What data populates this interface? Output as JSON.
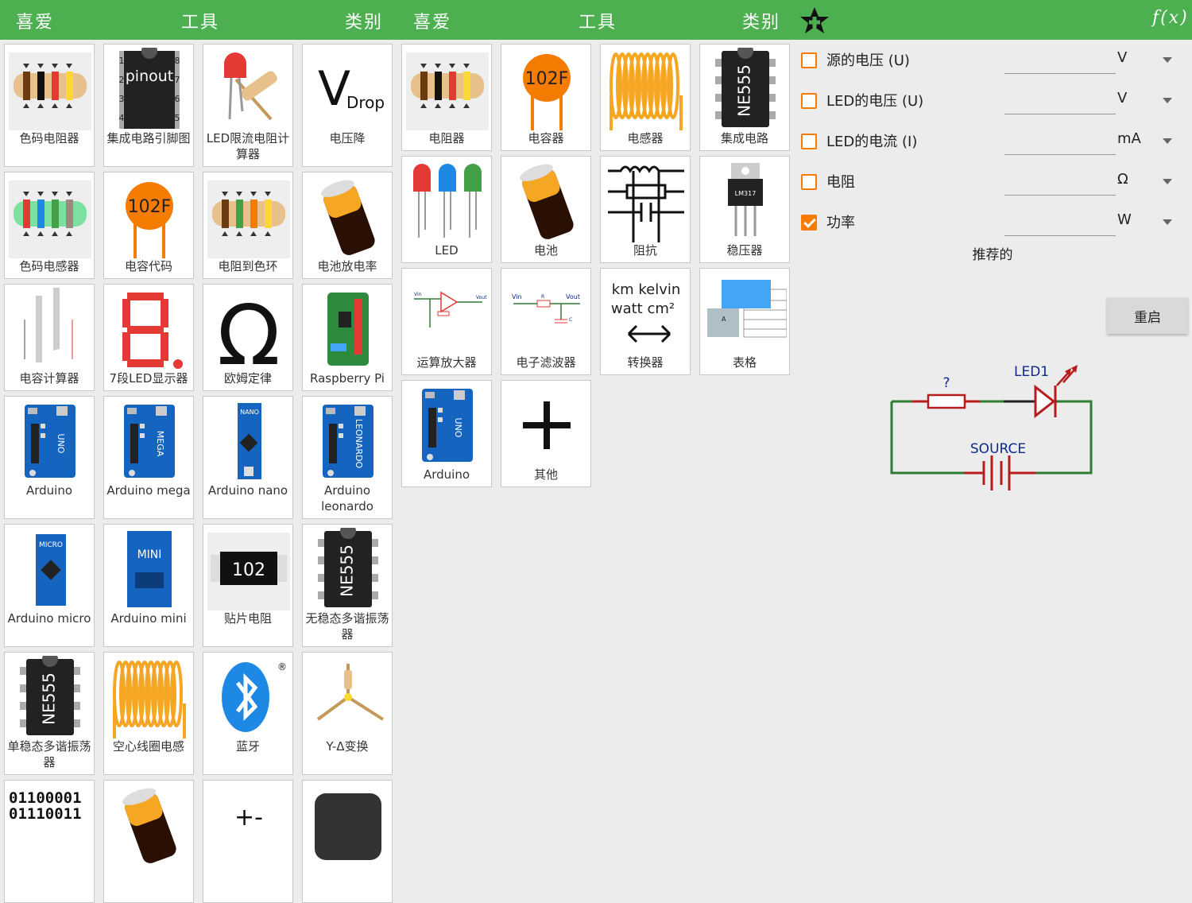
{
  "header_left": {
    "fav": "喜爱",
    "tools": "工具",
    "cat": "类别"
  },
  "header_mid": {
    "fav": "喜爱",
    "tools": "工具",
    "cat": "类别"
  },
  "header_right": {
    "fx": "f(x)"
  },
  "tools_grid": [
    {
      "label": "色码电阻器",
      "icon": "color-resistor-icon"
    },
    {
      "label": "集成电路引脚图",
      "icon": "ic-pinout-icon"
    },
    {
      "label": "LED限流电阻计算器",
      "icon": "led-resistor-icon"
    },
    {
      "label": "电压降",
      "icon": "vdrop-icon"
    },
    {
      "label": "色码电感器",
      "icon": "color-inductor-icon"
    },
    {
      "label": "电容代码",
      "icon": "capacitor-code-icon"
    },
    {
      "label": "电阻到色环",
      "icon": "resistor-to-color-icon"
    },
    {
      "label": "电池放电率",
      "icon": "battery-icon"
    },
    {
      "label": "电容计算器",
      "icon": "capacitor-plates-icon"
    },
    {
      "label": "7段LED显示器",
      "icon": "seven-segment-icon"
    },
    {
      "label": "欧姆定律",
      "icon": "omega-icon"
    },
    {
      "label": "Raspberry Pi",
      "icon": "raspberry-pi-icon"
    },
    {
      "label": "Arduino",
      "icon": "arduino-uno-icon"
    },
    {
      "label": "Arduino mega",
      "icon": "arduino-mega-icon"
    },
    {
      "label": "Arduino nano",
      "icon": "arduino-nano-icon"
    },
    {
      "label": "Arduino leonardo",
      "icon": "arduino-leonardo-icon"
    },
    {
      "label": "Arduino micro",
      "icon": "arduino-micro-icon"
    },
    {
      "label": "Arduino mini",
      "icon": "arduino-mini-icon"
    },
    {
      "label": "贴片电阻",
      "icon": "smd-resistor-icon"
    },
    {
      "label": "无稳态多谐振荡器",
      "icon": "ne555-icon"
    },
    {
      "label": "单稳态多谐振荡器",
      "icon": "ne555-icon"
    },
    {
      "label": "空心线圈电感",
      "icon": "coil-icon"
    },
    {
      "label": "蓝牙",
      "icon": "bluetooth-icon"
    },
    {
      "label": "Y-Δ变换",
      "icon": "y-delta-icon"
    },
    {
      "label": "",
      "icon": "binary-icon"
    },
    {
      "label": "",
      "icon": "battery-icon"
    },
    {
      "label": "",
      "icon": "misc-icon"
    },
    {
      "label": "",
      "icon": "dark-chip-icon"
    }
  ],
  "icon_text": {
    "pinout": "pinout",
    "pin_nums": [
      "1",
      "2",
      "3",
      "4",
      "8",
      "7",
      "6",
      "5"
    ],
    "vdrop_v": "V",
    "vdrop_sub": "Drop",
    "cap_code": "102F",
    "smd_code": "102",
    "ne555": "NE555",
    "uno": "UNO",
    "mega": "MEGA",
    "nano": "NANO",
    "leonardo": "LEONARDO",
    "micro": "MICRO",
    "mini": "MINI",
    "lm317": "LM317",
    "binary_line1": "01100001",
    "binary_line2": "01110011",
    "conv_line1": "km  kelvin",
    "conv_line2": "watt  cm²",
    "opamp_vin": "Vin",
    "opamp_vout": "Vout",
    "filter_vin": "Vin",
    "filter_vout": "Vout",
    "filter_r": "R",
    "filter_c": "C",
    "misc_char": "+-",
    "table_letter": "A"
  },
  "category_grid": [
    {
      "label": "电阻器",
      "icon": "color-resistor-icon"
    },
    {
      "label": "电容器",
      "icon": "capacitor-code-icon"
    },
    {
      "label": "电感器",
      "icon": "coil-icon"
    },
    {
      "label": "集成电路",
      "icon": "ne555-icon"
    },
    {
      "label": "LED",
      "icon": "led-rgb-icon"
    },
    {
      "label": "电池",
      "icon": "battery-icon"
    },
    {
      "label": "阻抗",
      "icon": "impedance-icon"
    },
    {
      "label": "稳压器",
      "icon": "regulator-icon"
    },
    {
      "label": "运算放大器",
      "icon": "opamp-icon"
    },
    {
      "label": "电子滤波器",
      "icon": "filter-icon"
    },
    {
      "label": "转换器",
      "icon": "converter-icon"
    },
    {
      "label": "表格",
      "icon": "table-icon"
    },
    {
      "label": "Arduino",
      "icon": "arduino-uno-icon"
    },
    {
      "label": "其他",
      "icon": "plus-icon"
    }
  ],
  "calculator": {
    "rows": [
      {
        "label": "源的电压 (U)",
        "value": "",
        "unit": "V",
        "checked": false
      },
      {
        "label": "LED的电压 (U)",
        "value": "",
        "unit": "V",
        "checked": false
      },
      {
        "label": "LED的电流 (I)",
        "value": "",
        "unit": "mA",
        "checked": false
      },
      {
        "label": "电阻",
        "value": "",
        "unit": "Ω",
        "checked": false
      },
      {
        "label": "功率",
        "value": "",
        "unit": "W",
        "checked": true
      }
    ],
    "recommend_label": "推荐的",
    "reset_label": "重启",
    "circuit": {
      "resistor_label": "?",
      "led_label": "LED1",
      "source_label": "SOURCE"
    }
  },
  "colors": {
    "header": "#4caf50",
    "accent": "#f57c00",
    "circuit_red": "#b71c1c",
    "circuit_green": "#2e7d32",
    "circuit_blue": "#0d2a8a"
  }
}
